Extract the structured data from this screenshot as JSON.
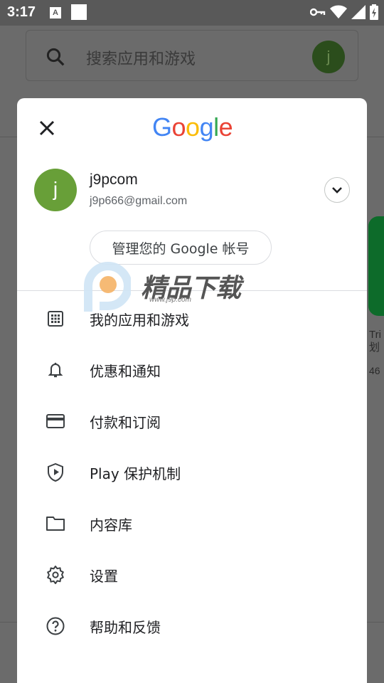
{
  "status_bar": {
    "time": "3:17",
    "notif_letter": "A"
  },
  "background": {
    "search_placeholder": "搜索应用和游戏",
    "avatar_letter": "j",
    "side_text_1": "Tri",
    "side_text_2": "划",
    "side_text_3": "46"
  },
  "dialog": {
    "logo_letters": [
      "G",
      "o",
      "o",
      "g",
      "l",
      "e"
    ],
    "logo_colors": [
      "#4285F4",
      "#EA4335",
      "#FBBC05",
      "#4285F4",
      "#34A853",
      "#EA4335"
    ],
    "account": {
      "avatar_letter": "j",
      "name": "j9pcom",
      "email": "j9p666@gmail.com"
    },
    "manage_label": "管理您的 Google 帐号",
    "menu": [
      {
        "label": "我的应用和游戏",
        "icon": "apps-grid-icon"
      },
      {
        "label": "优惠和通知",
        "icon": "bell-icon"
      },
      {
        "label": "付款和订阅",
        "icon": "credit-card-icon"
      },
      {
        "label": "Play 保护机制",
        "icon": "play-protect-shield-icon"
      },
      {
        "label": "内容库",
        "icon": "folder-icon"
      },
      {
        "label": "设置",
        "icon": "gear-icon"
      },
      {
        "label": "帮助和反馈",
        "icon": "help-icon"
      }
    ]
  },
  "watermark": {
    "title": "精品下载",
    "url": "www.j9p.com"
  }
}
